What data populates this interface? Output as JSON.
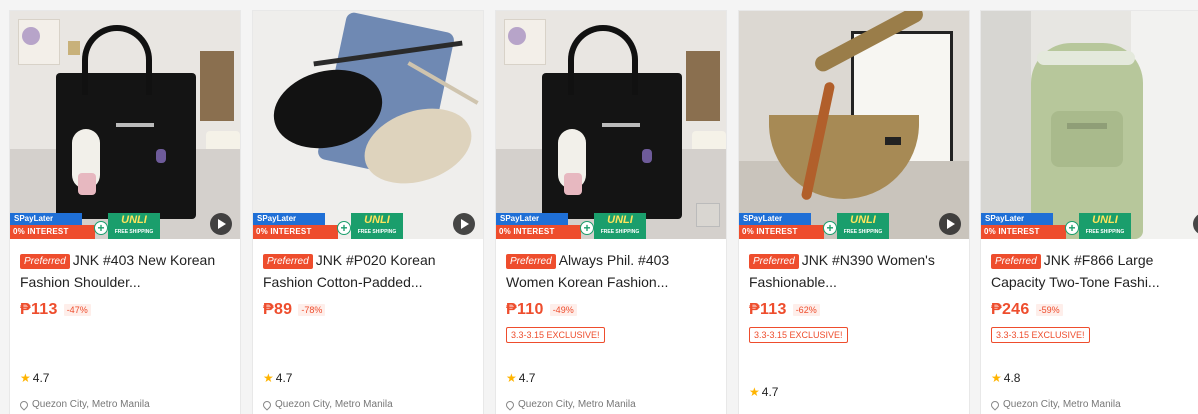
{
  "products": [
    {
      "badge": "Preferred",
      "title": "JNK #403 New Korean Fashion Shoulder...",
      "price": "₱113",
      "discount": "-47%",
      "exclusive": "",
      "rating": "4.7",
      "location": "Quezon City, Metro Manila",
      "image_desc": "black tote bag with bunny charm"
    },
    {
      "badge": "Preferred",
      "title": "JNK #P020 Korean Fashion Cotton-Padded...",
      "price": "₱89",
      "discount": "-78%",
      "exclusive": "",
      "rating": "4.7",
      "location": "Quezon City, Metro Manila",
      "image_desc": "black and beige belt bags"
    },
    {
      "badge": "Preferred",
      "title": "Always Phil. #403 Women Korean Fashion...",
      "price": "₱110",
      "discount": "-49%",
      "exclusive": "3.3-3.15 EXCLUSIVE!",
      "rating": "4.7",
      "location": "Quezon City, Metro Manila",
      "image_desc": "black tote bag with bunny charm"
    },
    {
      "badge": "Preferred",
      "title": "JNK #N390 Women's Fashionable...",
      "price": "₱113",
      "discount": "-62%",
      "exclusive": "3.3-3.15 EXCLUSIVE!",
      "rating": "4.7",
      "location": "",
      "image_desc": "khaki crescent shoulder bag"
    },
    {
      "badge": "Preferred",
      "title": "JNK #F866 Large Capacity Two-Tone Fashi...",
      "price": "₱246",
      "discount": "-59%",
      "exclusive": "3.3-3.15 EXCLUSIVE!",
      "rating": "4.8",
      "location": "Quezon City, Metro Manila",
      "image_desc": "sage green backpack"
    }
  ],
  "promo": {
    "spaylater": "SPayLater",
    "interest": "0% INTEREST",
    "unli": "UNLI",
    "free_shipping": "FREE SHIPPING"
  },
  "colors": {
    "accent": "#ee4d2d",
    "spay_blue": "#1f6fd6",
    "unli_green": "#1a9e6c",
    "star": "#ffb400"
  }
}
